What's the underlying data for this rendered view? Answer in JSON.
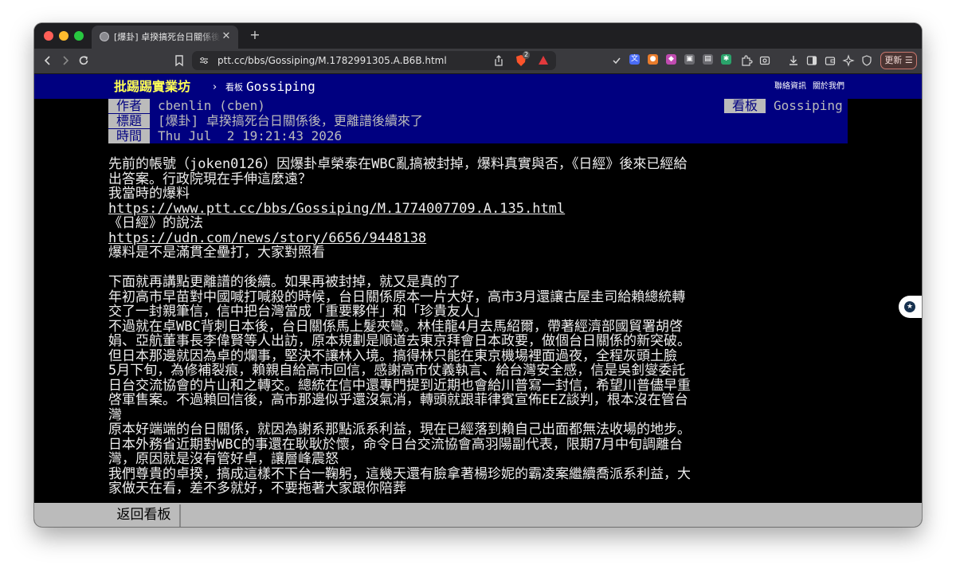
{
  "browser": {
    "tab_title": "[爆卦] 卓揆搞死台日關係後，更離譜後續來了",
    "url": "ptt.cc/bbs/Gossiping/M.1782991305.A.B6B.html",
    "shield_badge": "2",
    "update_label": "更新",
    "icons": {
      "back": "back-arrow-icon",
      "forward": "forward-arrow-icon",
      "reload": "reload-icon",
      "bookmark": "bookmark-icon",
      "site_settings": "site-settings-icon",
      "share": "share-icon",
      "download": "download-icon",
      "sidebar": "sidebar-icon",
      "wallet": "wallet-icon",
      "extensions": "puzzle-icon"
    }
  },
  "site": {
    "brand": "批踢踢實業坊",
    "crumb_arrow": "›",
    "crumb_label": "看板",
    "board": "Gossiping",
    "links": {
      "contact": "聯絡資訊",
      "about": "關於我們"
    }
  },
  "article": {
    "author_tag": "作者",
    "author": "cbenlin (cben)",
    "title_tag": "標題",
    "title": "[爆卦] 卓揆搞死台日關係後，更離譜後續來了",
    "time_tag": "時間",
    "time": "Thu Jul  2 19:21:43 2026",
    "board_tag": "看板",
    "board": "Gossiping",
    "lines": [
      {
        "text": "先前的帳號（joken0126）因爆卦卓榮泰在WBC亂搞被封掉，爆料真實與否，《日經》後來已經給出答案。行政院現在手伸這麼遠？",
        "link": false
      },
      {
        "text": "我當時的爆料",
        "link": false
      },
      {
        "text": "https://www.ptt.cc/bbs/Gossiping/M.1774007709.A.135.html",
        "link": true
      },
      {
        "text": "《日經》的說法",
        "link": false
      },
      {
        "text": "https://udn.com/news/story/6656/9448138",
        "link": true
      },
      {
        "text": "爆料是不是滿貫全壘打，大家對照看",
        "link": false
      },
      {
        "text": "",
        "link": false
      },
      {
        "text": "下面就再講點更離譜的後續。如果再被封掉，就又是真的了",
        "link": false
      },
      {
        "text": "年初高市早苗對中國喊打喊殺的時候，台日關係原本一片大好，高市3月還讓古屋圭司給賴總統轉交了一封親筆信，信中把台灣當成「重要夥伴」和「珍貴友人」",
        "link": false
      },
      {
        "text": "不過就在卓WBC背刺日本後，台日關係馬上髮夾彎。林佳龍4月去馬紹爾，帶著經濟部國貿署胡啓娟、亞航董事長李偉賢等人出訪，原本規劃是順道去東京拜會日本政要，做個台日關係的新突破。但日本那邊就因為卓的爛事，堅決不讓林入境。搞得林只能在東京機場裡面過夜，全程灰頭土臉",
        "link": false
      },
      {
        "text": "5月下旬，為修補裂痕，賴親自給高市回信，感謝高市仗義執言、給台灣安全感，信是吳釗燮委託日台交流協會的片山和之轉交。總統在信中還專門提到近期也會給川普寫一封信，希望川普儘早重啓軍售案。不過賴回信後，高市那邊似乎還沒氣消，轉頭就跟菲律賓宣佈EEZ談判，根本沒在管台灣",
        "link": false
      },
      {
        "text": "原本好端端的台日關係，就因為謝系那點派系利益，現在已經落到賴自己出面都無法收場的地步。日本外務省近期對WBC的事還在耿耿於懷，命令日台交流協會高羽陽副代表，限期7月中旬調離台灣，原因就是沒有管好卓，讓層峰震怒",
        "link": false
      },
      {
        "text": "我們尊貴的卓揆，搞成這樣不下台一鞠躬，這幾天還有臉拿著楊珍妮的霸凌案繼續喬派系利益，大家做天在看，差不多就好，不要拖著大家跟你陪葬",
        "link": false
      }
    ]
  },
  "footer": {
    "back_board": "返回看板"
  },
  "colors": {
    "header_bg": "#000080",
    "brand": "#ffff55",
    "tag_bg": "#bbbbbb",
    "text": "#eeeeee"
  }
}
